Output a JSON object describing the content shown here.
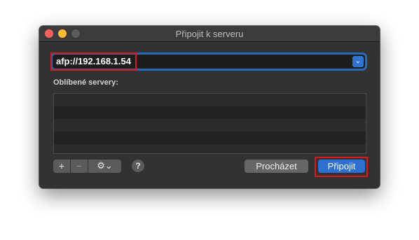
{
  "window": {
    "title": "Připojit k serveru"
  },
  "address": {
    "value": "afp://192.168.1.54"
  },
  "favorites": {
    "label": "Oblíbené servery:",
    "rows": [
      "",
      "",
      "",
      "",
      ""
    ]
  },
  "toolbar": {
    "add_symbol": "+",
    "remove_symbol": "−",
    "gear_symbol": "⚙︎⌄",
    "help_symbol": "?"
  },
  "buttons": {
    "browse_label": "Procházet",
    "connect_label": "Připojit"
  },
  "colors": {
    "window_bg": "#323232",
    "accent": "#2f6fd1",
    "highlight": "#e0161d"
  }
}
